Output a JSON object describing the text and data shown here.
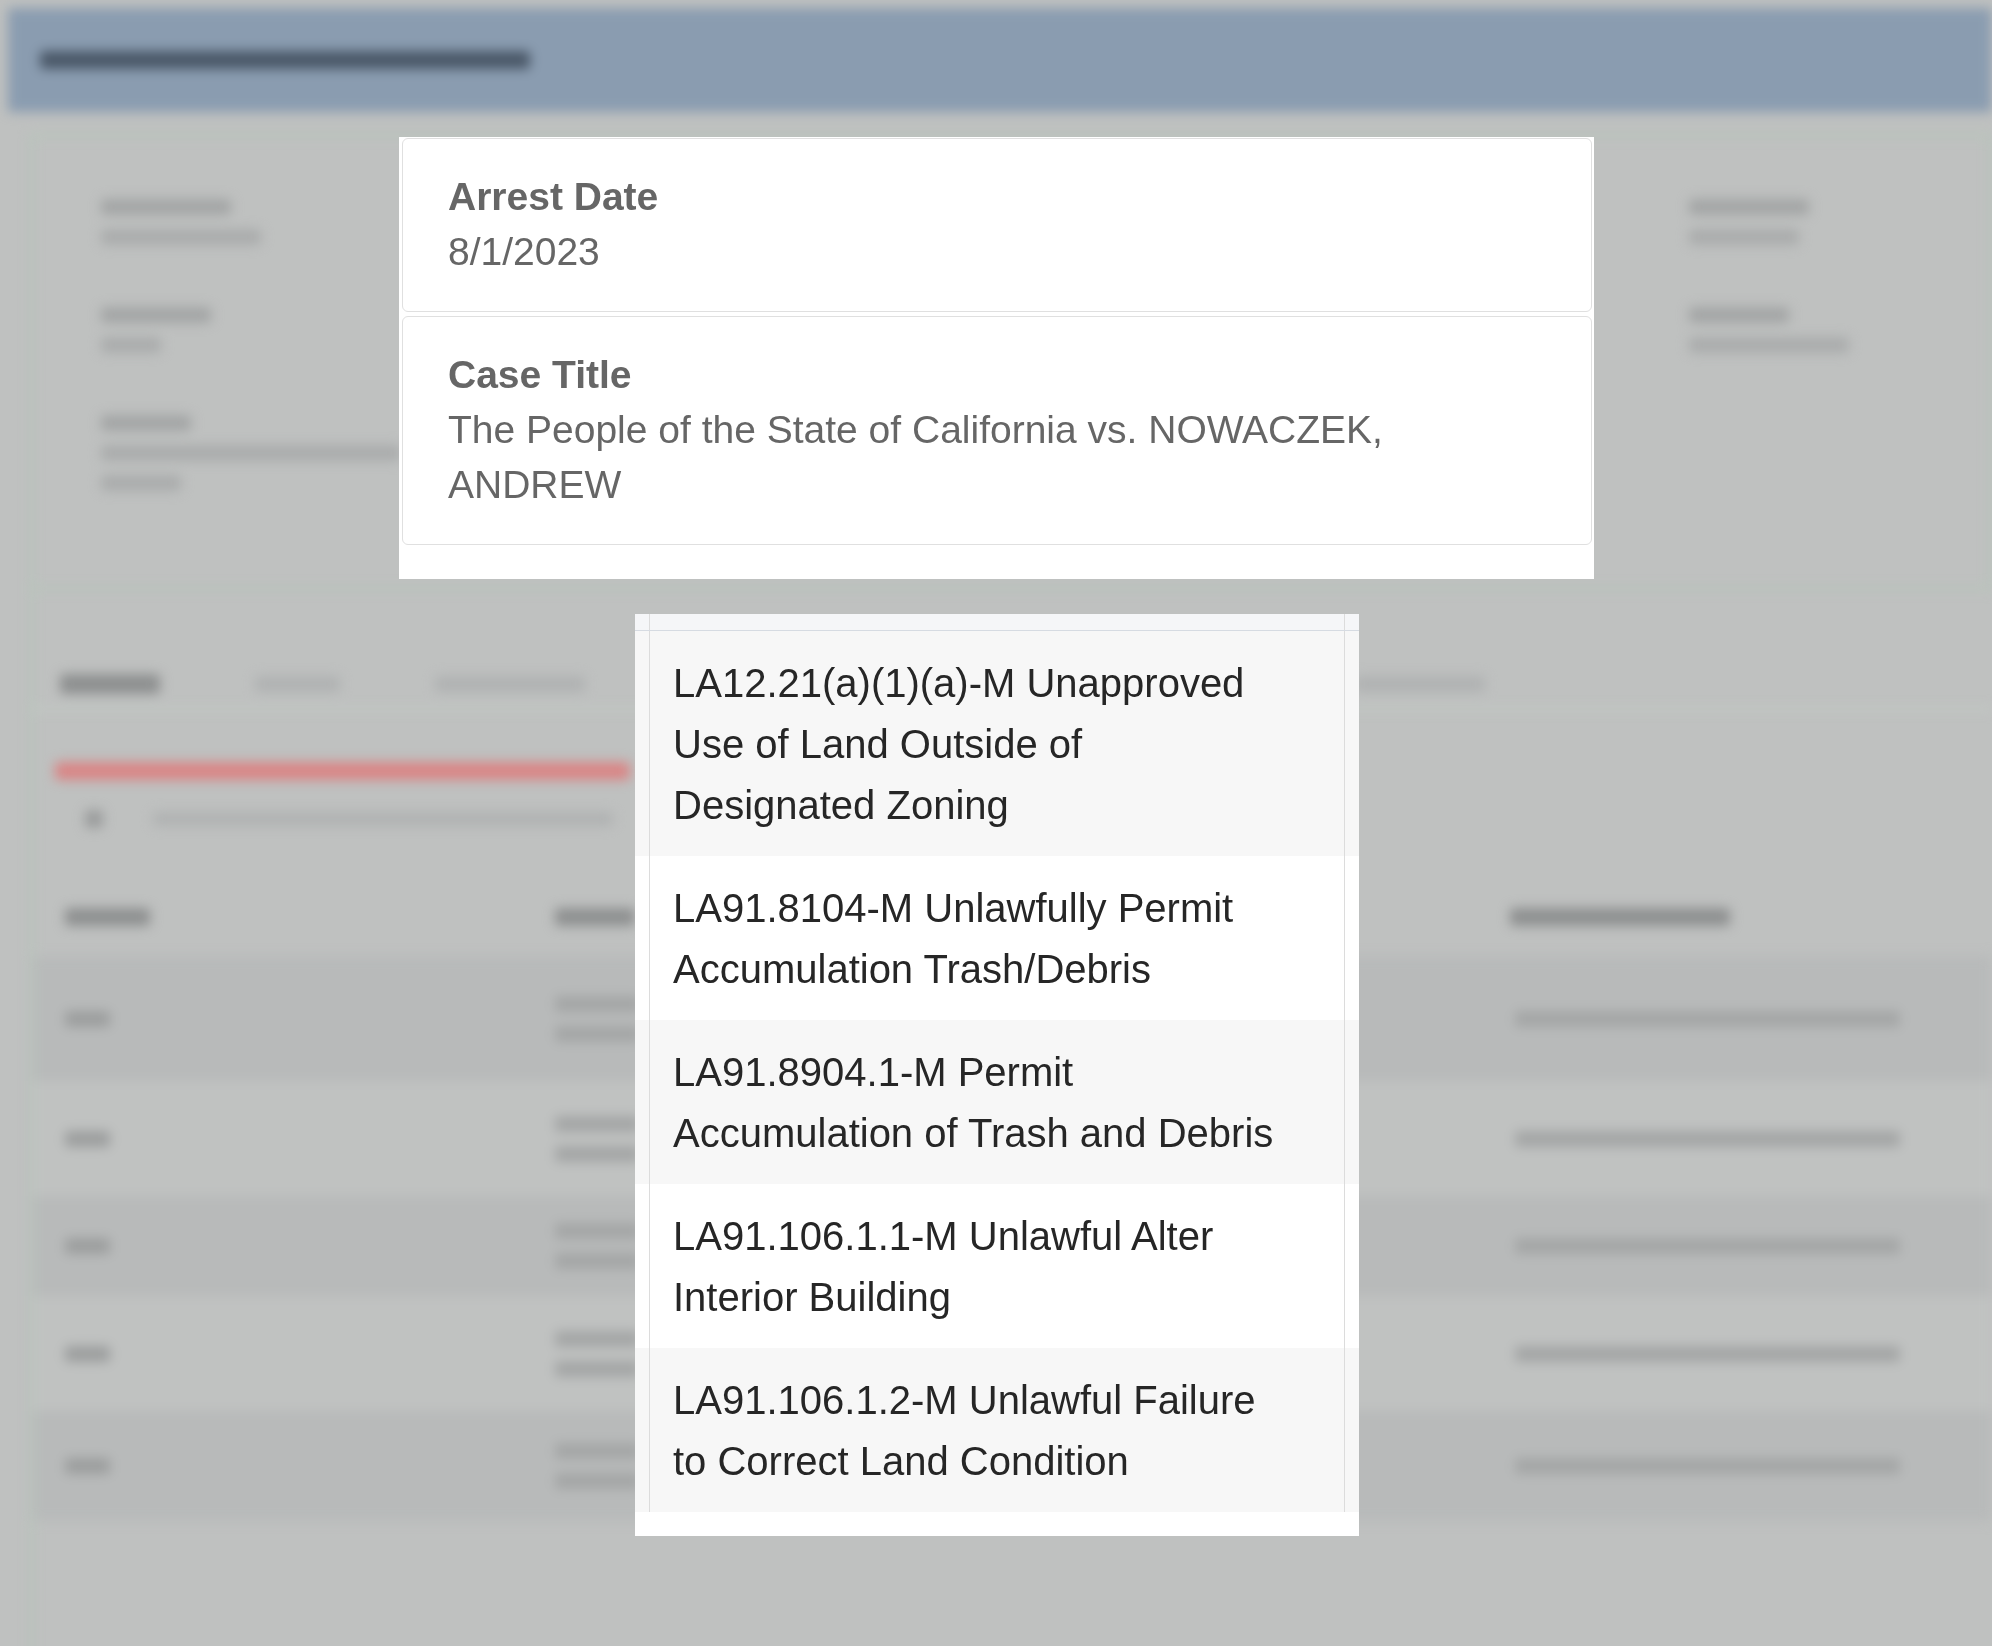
{
  "case_details": [
    {
      "label": "Arrest Date",
      "value": "8/1/2023"
    },
    {
      "label": "Case Title",
      "value": "The People of the State of California vs. NOWACZEK, ANDREW"
    }
  ],
  "charges_table": {
    "rows": [
      {
        "charge": "LA12.21(a)(1)(a)-M Unapproved Use of Land Outside of Designated Zoning"
      },
      {
        "charge": "LA91.8104-M Unlawfully Permit Accumulation Trash/Debris"
      },
      {
        "charge": "LA91.8904.1-M Permit Accumulation of Trash and Debris"
      },
      {
        "charge": "LA91.106.1.1-M Unlawful Alter Interior Building"
      },
      {
        "charge": "LA91.106.1.2-M Unlawful Failure to Correct Land Condition"
      }
    ]
  }
}
